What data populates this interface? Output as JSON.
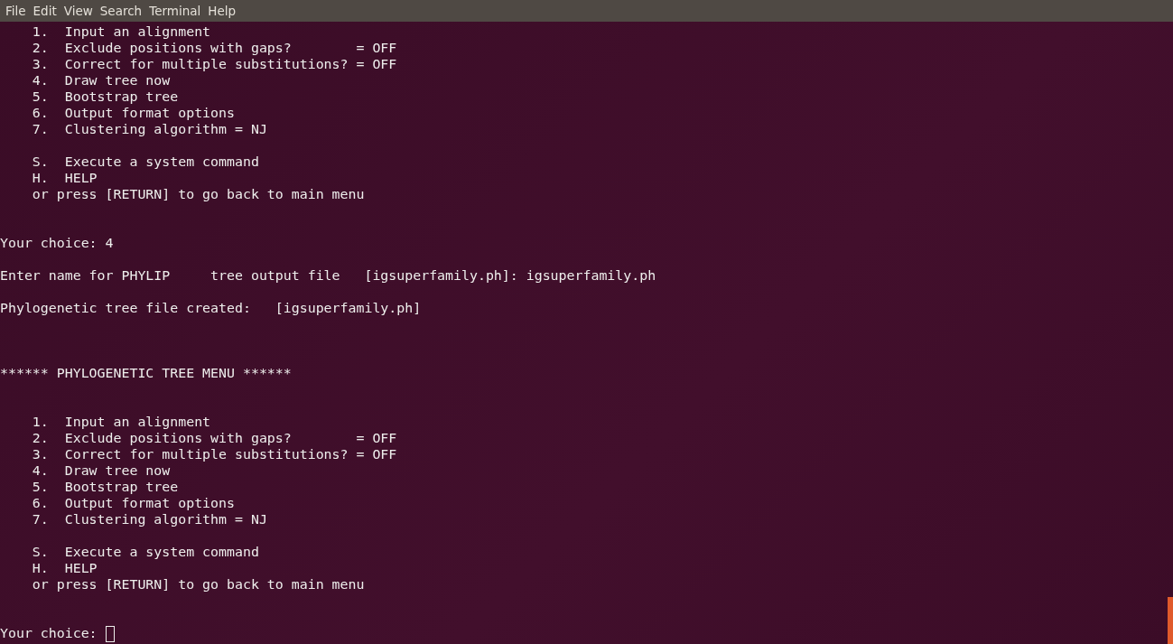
{
  "menu_bar": [
    "File",
    "Edit",
    "View",
    "Search",
    "Terminal",
    "Help"
  ],
  "terminal_lines": [
    {
      "kind": "text",
      "text": "    1.  Input an alignment"
    },
    {
      "kind": "text",
      "text": "    2.  Exclude positions with gaps?        = OFF"
    },
    {
      "kind": "text",
      "text": "    3.  Correct for multiple substitutions? = OFF"
    },
    {
      "kind": "text",
      "text": "    4.  Draw tree now"
    },
    {
      "kind": "text",
      "text": "    5.  Bootstrap tree"
    },
    {
      "kind": "text",
      "text": "    6.  Output format options"
    },
    {
      "kind": "text",
      "text": "    7.  Clustering algorithm = NJ"
    },
    {
      "kind": "blank"
    },
    {
      "kind": "text",
      "text": "    S.  Execute a system command"
    },
    {
      "kind": "text",
      "text": "    H.  HELP"
    },
    {
      "kind": "text",
      "text": "    or press [RETURN] to go back to main menu"
    },
    {
      "kind": "blank"
    },
    {
      "kind": "blank"
    },
    {
      "kind": "text",
      "text": "Your choice: 4"
    },
    {
      "kind": "blank"
    },
    {
      "kind": "text",
      "text": "Enter name for PHYLIP     tree output file   [igsuperfamily.ph]: igsuperfamily.ph"
    },
    {
      "kind": "blank"
    },
    {
      "kind": "text",
      "text": "Phylogenetic tree file created:   [igsuperfamily.ph]"
    },
    {
      "kind": "blank"
    },
    {
      "kind": "blank"
    },
    {
      "kind": "blank"
    },
    {
      "kind": "text",
      "text": "****** PHYLOGENETIC TREE MENU ******"
    },
    {
      "kind": "blank"
    },
    {
      "kind": "blank"
    },
    {
      "kind": "text",
      "text": "    1.  Input an alignment"
    },
    {
      "kind": "text",
      "text": "    2.  Exclude positions with gaps?        = OFF"
    },
    {
      "kind": "text",
      "text": "    3.  Correct for multiple substitutions? = OFF"
    },
    {
      "kind": "text",
      "text": "    4.  Draw tree now"
    },
    {
      "kind": "text",
      "text": "    5.  Bootstrap tree"
    },
    {
      "kind": "text",
      "text": "    6.  Output format options"
    },
    {
      "kind": "text",
      "text": "    7.  Clustering algorithm = NJ"
    },
    {
      "kind": "blank"
    },
    {
      "kind": "text",
      "text": "    S.  Execute a system command"
    },
    {
      "kind": "text",
      "text": "    H.  HELP"
    },
    {
      "kind": "text",
      "text": "    or press [RETURN] to go back to main menu"
    },
    {
      "kind": "blank"
    },
    {
      "kind": "blank"
    },
    {
      "kind": "prompt",
      "text": "Your choice: "
    }
  ]
}
